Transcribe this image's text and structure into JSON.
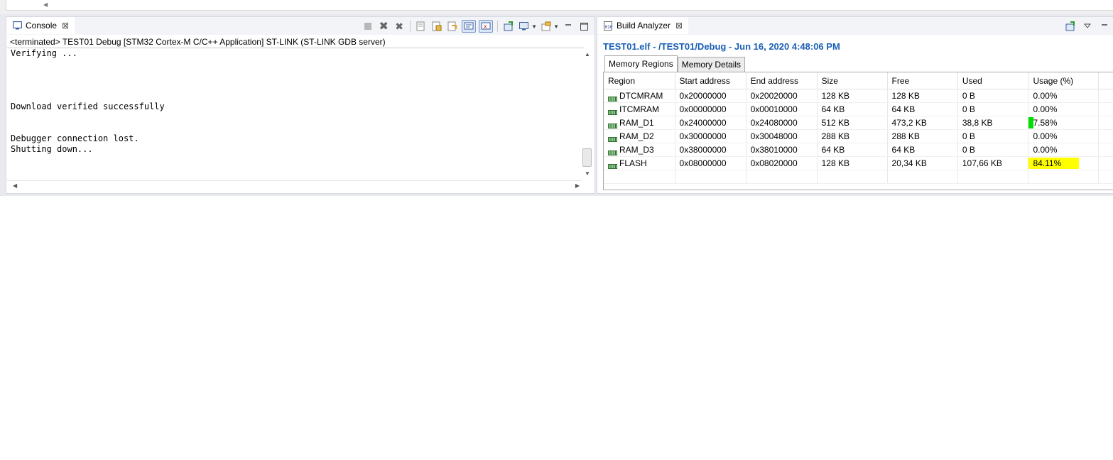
{
  "console": {
    "tab_label": "Console",
    "header": "<terminated> TEST01 Debug [STM32 Cortex-M C/C++ Application] ST-LINK (ST-LINK GDB server)",
    "lines": [
      "Verifying ...",
      "",
      "",
      "",
      "",
      "Download verified successfully",
      "",
      "",
      "Debugger connection lost.",
      "Shutting down..."
    ]
  },
  "analyzer": {
    "tab_label": "Build Analyzer",
    "title": "TEST01.elf - /TEST01/Debug - Jun 16, 2020 4:48:06 PM",
    "subtabs": [
      "Memory Regions",
      "Memory Details"
    ],
    "columns": [
      "Region",
      "Start address",
      "End address",
      "Size",
      "Free",
      "Used",
      "Usage (%)"
    ],
    "rows": [
      {
        "region": "DTCMRAM",
        "start": "0x20000000",
        "end": "0x20020000",
        "size": "128 KB",
        "free": "128 KB",
        "used": "0 B",
        "usage": "0.00%",
        "usage_fraction": 0.0,
        "usage_color": "#00e000"
      },
      {
        "region": "ITCMRAM",
        "start": "0x00000000",
        "end": "0x00010000",
        "size": "64 KB",
        "free": "64 KB",
        "used": "0 B",
        "usage": "0.00%",
        "usage_fraction": 0.0,
        "usage_color": "#00e000"
      },
      {
        "region": "RAM_D1",
        "start": "0x24000000",
        "end": "0x24080000",
        "size": "512 KB",
        "free": "473,2 KB",
        "used": "38,8 KB",
        "usage": "7.58%",
        "usage_fraction": 0.0758,
        "usage_color": "#00e000"
      },
      {
        "region": "RAM_D2",
        "start": "0x30000000",
        "end": "0x30048000",
        "size": "288 KB",
        "free": "288 KB",
        "used": "0 B",
        "usage": "0.00%",
        "usage_fraction": 0.0,
        "usage_color": "#00e000"
      },
      {
        "region": "RAM_D3",
        "start": "0x38000000",
        "end": "0x38010000",
        "size": "64 KB",
        "free": "64 KB",
        "used": "0 B",
        "usage": "0.00%",
        "usage_fraction": 0.0,
        "usage_color": "#00e000"
      },
      {
        "region": "FLASH",
        "start": "0x08000000",
        "end": "0x08020000",
        "size": "128 KB",
        "free": "20,34 KB",
        "used": "107,66 KB",
        "usage": "84.11%",
        "usage_fraction": 0.8411,
        "usage_color": "#ffff00"
      }
    ]
  },
  "colors": {
    "title_blue": "#1a5fb4",
    "accent_green": "#00e000",
    "accent_yellow": "#ffff00"
  }
}
